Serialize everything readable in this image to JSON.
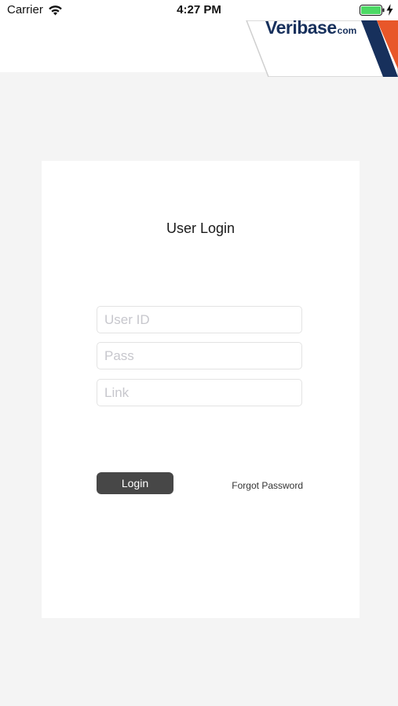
{
  "status_bar": {
    "carrier": "Carrier",
    "time": "4:27 PM",
    "icons": [
      "wifi-icon",
      "battery-icon",
      "charging-icon"
    ],
    "battery_color": "#4cd964"
  },
  "header": {
    "brand_first_letter": "V",
    "brand_rest": "eribase",
    "brand_suffix": "com",
    "brand_color": "#17305c",
    "accent_colors": [
      "#17305c",
      "#e8572a"
    ]
  },
  "login_card": {
    "title": "User Login",
    "fields": [
      {
        "name": "user-id",
        "placeholder": "User ID",
        "value": ""
      },
      {
        "name": "pass",
        "placeholder": "Pass",
        "value": ""
      },
      {
        "name": "link",
        "placeholder": "Link",
        "value": ""
      }
    ],
    "login_label": "Login",
    "forgot_label": "Forgot Password",
    "button_color": "#474747"
  }
}
